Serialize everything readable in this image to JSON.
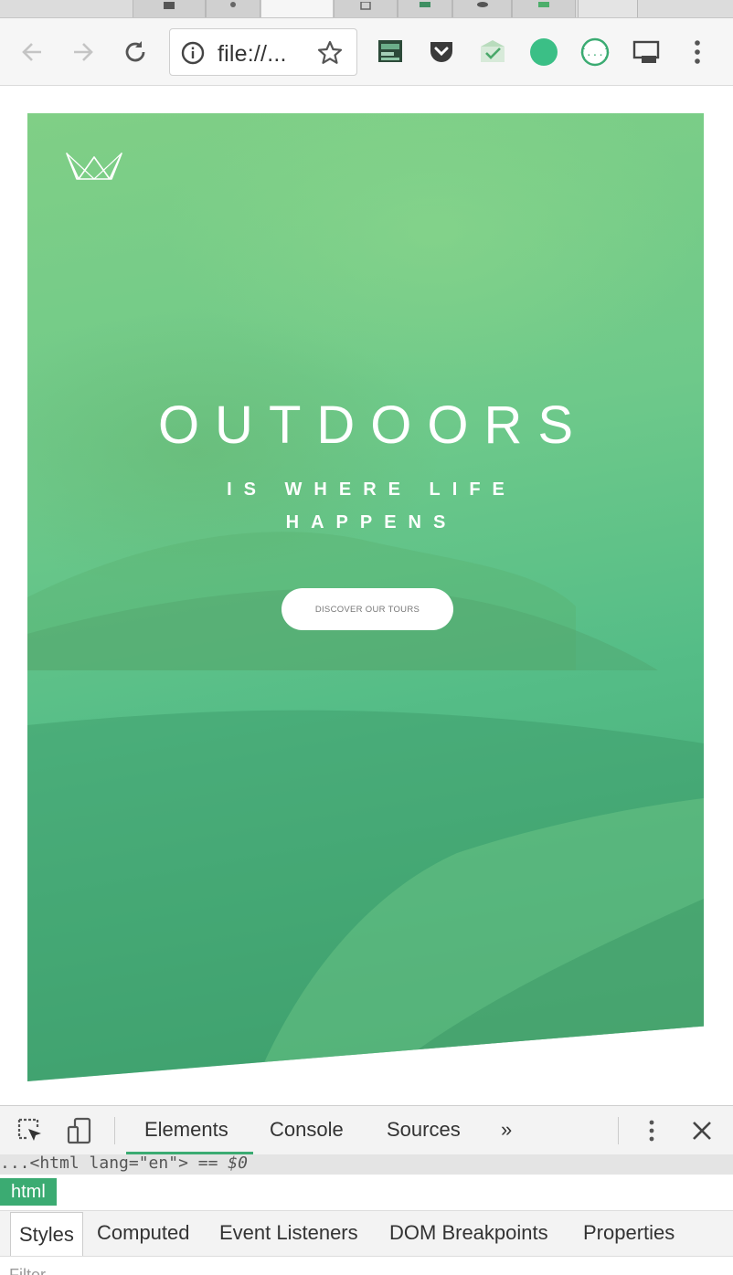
{
  "browser": {
    "tabs": [
      {
        "favicon": "tab-favicon-dark-square-icon"
      },
      {
        "favicon": "tab-favicon-gear-icon"
      },
      {
        "favicon": "active-tab"
      },
      {
        "favicon": "tab-favicon-document-icon"
      },
      {
        "favicon": "tab-favicon-green-square-icon"
      },
      {
        "favicon": "tab-favicon-github-icon"
      },
      {
        "favicon": "tab-favicon-green-icon"
      },
      {
        "favicon": "new-tab"
      }
    ],
    "address": {
      "url_display": "file://...",
      "security_icon": "info-icon",
      "bookmark_icon": "star-icon"
    },
    "nav": {
      "back_icon": "back-arrow-icon",
      "forward_icon": "forward-arrow-icon",
      "reload_icon": "reload-icon"
    },
    "extensions": [
      {
        "name": "image-extension-icon"
      },
      {
        "name": "pocket-icon"
      },
      {
        "name": "checkmark-extension-icon"
      },
      {
        "name": "green-circle-extension-icon"
      },
      {
        "name": "json-viewer-icon"
      },
      {
        "name": "cast-icon"
      },
      {
        "name": "menu-kebab-icon"
      }
    ]
  },
  "page": {
    "logo": "crown-logo-icon",
    "heading": "OUTDOORS",
    "subheading": "IS WHERE LIFE HAPPENS",
    "cta_label": "DISCOVER OUR TOURS",
    "colors": {
      "accent_green": "#55bd87",
      "light_green": "#80cf86",
      "dark_green": "#3fa571",
      "text_white": "#ffffff"
    }
  },
  "devtools": {
    "tabs": [
      {
        "label": "Elements",
        "active": true
      },
      {
        "label": "Console",
        "active": false
      },
      {
        "label": "Sources",
        "active": false
      }
    ],
    "more_tabs_label": "»",
    "selected_element_line": "...<html lang=\"en\"> == $0",
    "selected_element_tag_prefix": "...<html lang=\"en\">",
    "selected_element_eq": " == ",
    "selected_element_ref": "$0",
    "breadcrumb": "html",
    "subtabs": [
      {
        "label": "Styles",
        "active": true
      },
      {
        "label": "Computed",
        "active": false
      },
      {
        "label": "Event Listeners",
        "active": false
      },
      {
        "label": "DOM Breakpoints",
        "active": false
      },
      {
        "label": "Properties",
        "active": false
      }
    ],
    "filter_placeholder": "Filter",
    "accent": "#3bab72"
  }
}
